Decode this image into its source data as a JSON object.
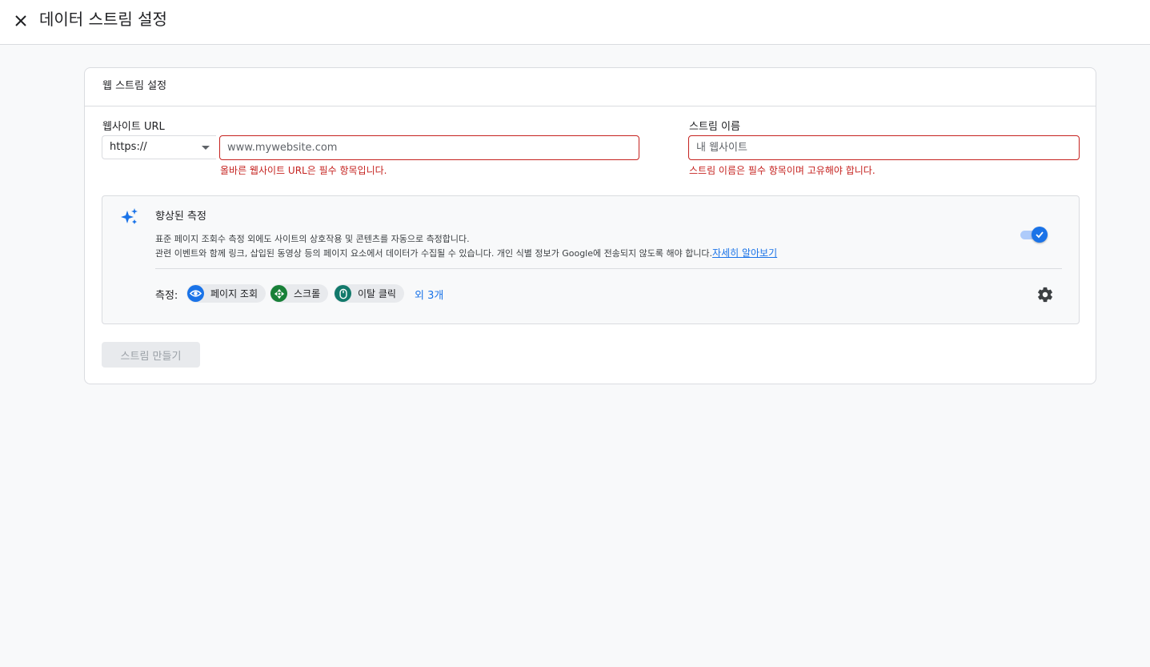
{
  "header": {
    "title": "데이터 스트림 설정"
  },
  "card": {
    "title": "웹 스트림 설정",
    "website_url": {
      "label": "웹사이트 URL",
      "protocol": "https://",
      "placeholder": "www.mywebsite.com",
      "error": "올바른 웹사이트 URL은 필수 항목입니다."
    },
    "stream_name": {
      "label": "스트림 이름",
      "placeholder": "내 웹사이트",
      "error": "스트림 이름은 필수 항목이며 고유해야 합니다."
    },
    "enhanced_measurement": {
      "title": "향상된 측정",
      "desc_line1": "표준 페이지 조회수 측정 외에도 사이트의 상호작용 및 콘텐츠를 자동으로 측정합니다.",
      "desc_line2": "관련 이벤트와 함께 링크, 삽입된 동영상 등의 페이지 요소에서 데이터가 수집될 수 있습니다. 개인 식별 정보가 Google에 전송되지 않도록 해야 합니다.",
      "learn_more": "자세히 알아보기",
      "enabled": true,
      "measure_label": "측정:",
      "chips": [
        {
          "label": "페이지 조회",
          "icon": "eye-icon",
          "color": "#1a73e8"
        },
        {
          "label": "스크롤",
          "icon": "scroll-icon",
          "color": "#188038"
        },
        {
          "label": "이탈 클릭",
          "icon": "mouse-icon",
          "color": "#12796b"
        }
      ],
      "more": "외 3개"
    },
    "create_button": "스트림 만들기"
  },
  "colors": {
    "accent": "#1a73e8",
    "error": "#c5221f"
  }
}
